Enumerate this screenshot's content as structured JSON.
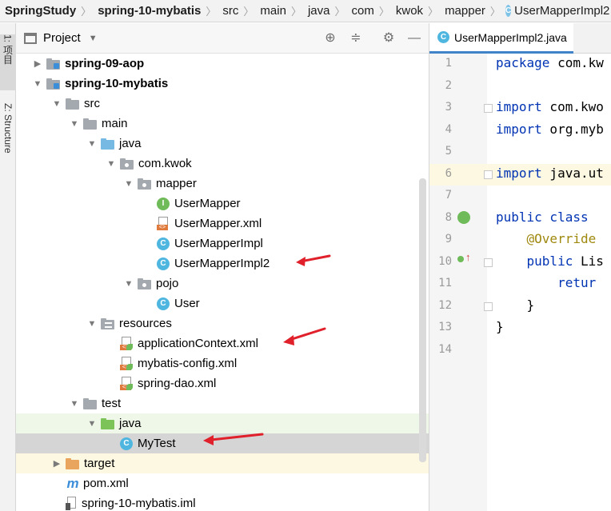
{
  "breadcrumb": [
    {
      "label": "SpringStudy",
      "bold": true
    },
    {
      "label": "spring-10-mybatis",
      "bold": true
    },
    {
      "label": "src",
      "bold": false
    },
    {
      "label": "main",
      "bold": false
    },
    {
      "label": "java",
      "bold": false
    },
    {
      "label": "com",
      "bold": false
    },
    {
      "label": "kwok",
      "bold": false
    },
    {
      "label": "mapper",
      "bold": false
    },
    {
      "label": "UserMapperImpl2",
      "bold": false
    }
  ],
  "toolstrip": {
    "project_tab": "1: 项目",
    "structure_tab": "Z: Structure"
  },
  "project_panel": {
    "title": "Project",
    "tree": [
      {
        "label": "spring-09-aop",
        "bold": true,
        "arrow": "▶",
        "icon": "module-folder-icon"
      },
      {
        "label": "spring-10-mybatis",
        "bold": true,
        "arrow": "▼",
        "icon": "module-folder-icon"
      },
      {
        "label": "src",
        "arrow": "▼",
        "icon": "folder-icon"
      },
      {
        "label": "main",
        "arrow": "▼",
        "icon": "folder-icon"
      },
      {
        "label": "java",
        "arrow": "▼",
        "icon": "source-folder-icon"
      },
      {
        "label": "com.kwok",
        "arrow": "▼",
        "icon": "package-icon"
      },
      {
        "label": "mapper",
        "arrow": "▼",
        "icon": "package-icon"
      },
      {
        "label": "UserMapper",
        "icon": "interface-icon"
      },
      {
        "label": "UserMapper.xml",
        "icon": "xml-file-icon"
      },
      {
        "label": "UserMapperImpl",
        "icon": "class-icon"
      },
      {
        "label": "UserMapperImpl2",
        "icon": "class-icon"
      },
      {
        "label": "pojo",
        "arrow": "▼",
        "icon": "package-icon"
      },
      {
        "label": "User",
        "icon": "class-icon"
      },
      {
        "label": "resources",
        "arrow": "▼",
        "icon": "resources-folder-icon"
      },
      {
        "label": "applicationContext.xml",
        "icon": "spring-xml-icon"
      },
      {
        "label": "mybatis-config.xml",
        "icon": "spring-xml-icon"
      },
      {
        "label": "spring-dao.xml",
        "icon": "spring-xml-icon"
      },
      {
        "label": "test",
        "arrow": "▼",
        "icon": "folder-icon"
      },
      {
        "label": "java",
        "arrow": "▼",
        "icon": "test-folder-icon"
      },
      {
        "label": "MyTest",
        "icon": "test-class-icon"
      },
      {
        "label": "target",
        "arrow": "▶",
        "icon": "excluded-folder-icon"
      },
      {
        "label": "pom.xml",
        "icon": "maven-icon"
      },
      {
        "label": "spring-10-mybatis.iml",
        "icon": "iml-file-icon"
      }
    ]
  },
  "editor": {
    "tab_label": "UserMapperImpl2.java",
    "lines": [
      {
        "n": "1",
        "html": "<span class=\"kw\">package</span> com.kw"
      },
      {
        "n": "2",
        "html": ""
      },
      {
        "n": "3",
        "html": "<span class=\"kw\">import</span> com.kwo"
      },
      {
        "n": "4",
        "html": "<span class=\"kw\">import</span> org.myb"
      },
      {
        "n": "5",
        "html": ""
      },
      {
        "n": "6",
        "html": "<span class=\"kw\">import</span> java.ut"
      },
      {
        "n": "7",
        "html": ""
      },
      {
        "n": "8",
        "html": "<span class=\"kw\">public class</span> "
      },
      {
        "n": "9",
        "html": "    <span class=\"an\">@Override</span>"
      },
      {
        "n": "10",
        "html": "    <span class=\"kw\">public</span> Lis"
      },
      {
        "n": "11",
        "html": "        <span class=\"kw\">retur</span>"
      },
      {
        "n": "12",
        "html": "    }"
      },
      {
        "n": "13",
        "html": "}"
      },
      {
        "n": "14",
        "html": ""
      }
    ]
  },
  "colors": {
    "accent": "#4083c9",
    "annotation_arrow": "#e0202a",
    "keyword": "#0033b3"
  }
}
